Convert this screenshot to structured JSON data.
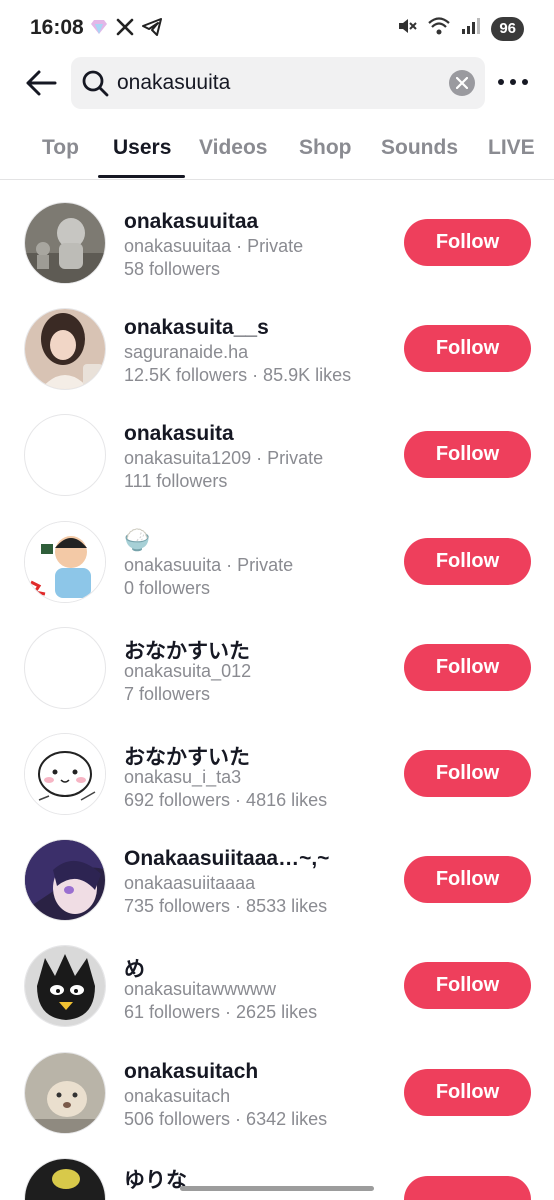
{
  "status": {
    "time": "16:08",
    "battery": "96",
    "left_icons": [
      "gem-icon",
      "x-icon",
      "telegram-icon"
    ],
    "right_icons": [
      "mute-icon",
      "wifi-icon",
      "signal-icon"
    ]
  },
  "search": {
    "query": "onakasuuita",
    "placeholder": "Search"
  },
  "tabs": [
    {
      "label": "Top",
      "active": false
    },
    {
      "label": "Users",
      "active": true
    },
    {
      "label": "Videos",
      "active": false
    },
    {
      "label": "Shop",
      "active": false
    },
    {
      "label": "Sounds",
      "active": false
    },
    {
      "label": "LIVE",
      "active": false
    }
  ],
  "users": [
    {
      "name": "onakasuuitaa",
      "line2": "onakasuuitaa · Private",
      "line3": "58 followers",
      "follow": "Follow",
      "avatar": "statue-photo"
    },
    {
      "name": "onakasuita__s",
      "line2": "saguranaide.ha",
      "line3": "12.5K followers · 85.9K likes",
      "follow": "Follow",
      "avatar": "person-photo"
    },
    {
      "name": "onakasuita",
      "line2": "onakasuita1209 · Private",
      "line3": "111 followers",
      "follow": "Follow",
      "avatar": "empty"
    },
    {
      "name": "🍚",
      "line2": "onakasuuita · Private",
      "line3": "0 followers",
      "follow": "Follow",
      "avatar": "illustration"
    },
    {
      "name": "おなかすいた",
      "line2": "onakasuita_012",
      "line3": "7 followers",
      "follow": "Follow",
      "avatar": "empty"
    },
    {
      "name": "おなかすいた",
      "line2": "onakasu_i_ta3",
      "line3": "692 followers · 4816 likes",
      "follow": "Follow",
      "avatar": "hamster-drawing"
    },
    {
      "name": "Onakaasuiitaaa…~,~",
      "line2": "onakaasuiitaaaa",
      "line3": "735 followers · 8533 likes",
      "follow": "Follow",
      "avatar": "anime-girl"
    },
    {
      "name": "め",
      "line2": "onakasuitawwwww",
      "line3": "61 followers · 2625 likes",
      "follow": "Follow",
      "avatar": "badtz-maru"
    },
    {
      "name": "onakasuitach",
      "line2": "onakasuitach",
      "line3": "506 followers · 6342 likes",
      "follow": "Follow",
      "avatar": "dog-photo"
    }
  ],
  "partial_user": {
    "name": "ゆりな"
  }
}
